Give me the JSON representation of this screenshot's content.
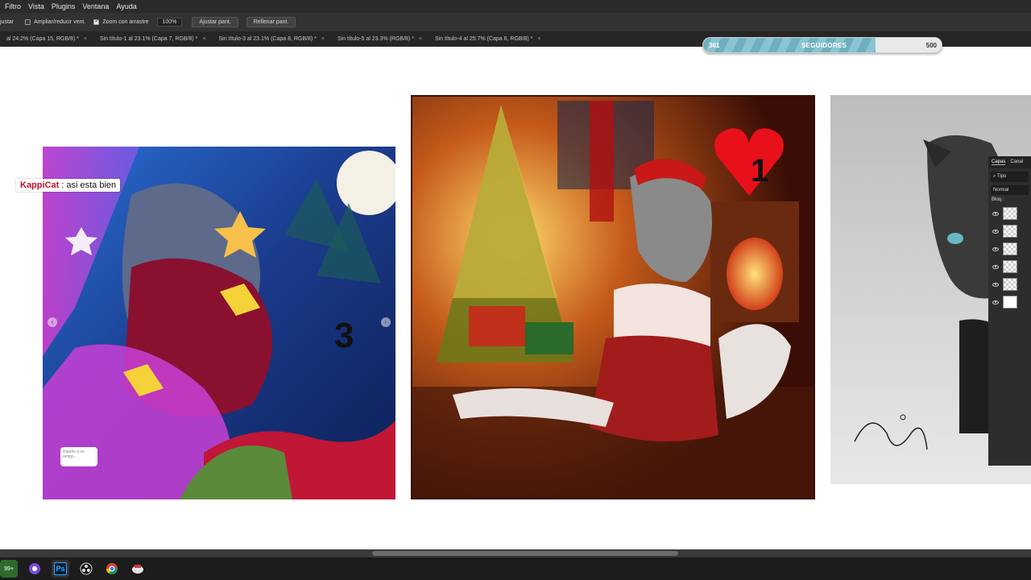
{
  "menu": [
    "Filtro",
    "Vista",
    "Plugins",
    "Ventana",
    "Ayuda"
  ],
  "options": {
    "fit_label": "justar",
    "resize_windows": "Ampliar/reducir vent.",
    "resize_checked": false,
    "scrubby_zoom": "Zoom con arrastre",
    "scrubby_checked": true,
    "zoom_value": "100%",
    "fit_screen": "Ajustar pant.",
    "fill_screen": "Rellenar pant."
  },
  "tabs": [
    {
      "title": "al 24.2% (Capa 15, RGB/8) *"
    },
    {
      "title": "Sin título-1 al 23.1% (Capa 7, RGB/8) *"
    },
    {
      "title": "Sin título-3 al 23.1% (Capa 8, RGB/8) *"
    },
    {
      "title": "Sin título-5 al 23.3% (RGB/8) *"
    },
    {
      "title": "Sin título-4 al 25.7% (Capa 6, RGB/8) *"
    }
  ],
  "followers": {
    "current": "361",
    "label": "SEGUIDORES",
    "goal": "500",
    "progress": 0.722
  },
  "chat": {
    "user": "KappiCat",
    "message": ": asi esta bien"
  },
  "artworks": {
    "left_number": "3",
    "center_number": "1",
    "left_tooltip": "Rápido a un amigo..."
  },
  "layers_panel": {
    "tabs": [
      "Capas",
      "Canal"
    ],
    "search": "Tipo",
    "blend_mode": "Normal",
    "lock_label": "Bloq.:",
    "layer_count": 6
  },
  "taskbar": {
    "badge": "99+",
    "apps": [
      "browser-icon",
      "ps-icon",
      "obs-icon",
      "chrome-icon",
      "app-icon"
    ],
    "ps_label": "Ps"
  },
  "colors": {
    "chat_user": "#c4102d",
    "progress_fill": "#7fbccb"
  }
}
